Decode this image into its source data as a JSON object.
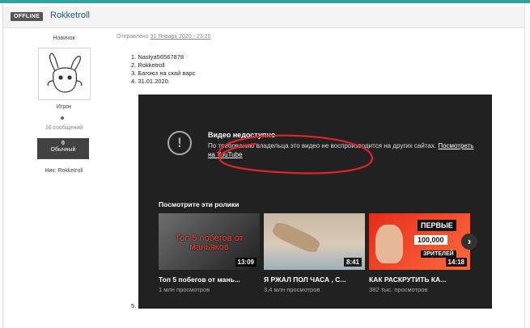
{
  "header": {
    "status_badge": "OFFLINE",
    "username": "Rokketroll"
  },
  "profile": {
    "rank": "Новичок",
    "group": "Игрок",
    "posts": "16 сообщений",
    "reputation": {
      "value": "0",
      "label": "Обычный"
    },
    "nick": "Ник: Rokketroll"
  },
  "post": {
    "posted_prefix": "Отправлено",
    "posted_date": "31 Январь 2020 - 23:20",
    "items": [
      "1. Nastya56567878",
      "2. Rokketroll",
      "3. Багоюз на скай варс",
      "4. 31.01.2020.",
      "5."
    ]
  },
  "video": {
    "title": "Видео недоступно",
    "message": "По требованию владельца это видео не воспроизводится на других сайтах.",
    "link": "Посмотреть на YouTube",
    "watch_heading": "Посмотрите эти ролики",
    "suggestions": [
      {
        "thumb_text": "Топ 5 побегов от маньяков",
        "duration": "13:09",
        "title": "Топ 5 побегов от мань...",
        "views": "1 млн просмотров"
      },
      {
        "duration": "8:41",
        "title": "Я РЖАЛ ПОЛ ЧАСА , С...",
        "views": "3,4 млн просмотров"
      },
      {
        "thumb_line1": "ПЕРВЫЕ",
        "thumb_line2": "100,000",
        "thumb_line3": "ЗРИТЕЛЕЙ",
        "duration": "14:18",
        "title": "КАК РАСКРУТИТЬ КА...",
        "views": "382 тыс. просмотров"
      }
    ],
    "next_glyph": "›"
  },
  "colors": {
    "accent": "#2fa3a0",
    "link": "#1d5a8e",
    "player_bg": "#212121",
    "annotation": "#e0222a"
  }
}
